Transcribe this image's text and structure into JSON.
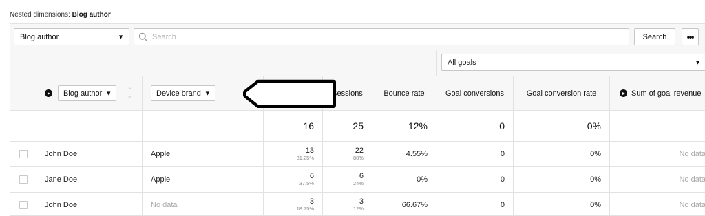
{
  "nested": {
    "prefix": "Nested dimensions:",
    "value": "Blog author"
  },
  "toolbar": {
    "dimension_select": "Blog author",
    "search_placeholder": "Search",
    "search_value": "",
    "search_button": "Search",
    "more_button": "•••"
  },
  "goals": {
    "selected": "All goals"
  },
  "columns": {
    "blog_author": "Blog author",
    "device_brand": "Device brand",
    "sessions": "Sessions",
    "bounce_rate": "Bounce rate",
    "goal_conversions": "Goal conversions",
    "goal_conversion_rate": "Goal conversion rate",
    "sum_goal_revenue": "Sum of goal revenue"
  },
  "totals": {
    "col3": "16",
    "sessions": "25",
    "bounce_rate": "12%",
    "goal_conversions": "0",
    "goal_conversion_rate": "0%"
  },
  "rows": [
    {
      "author": "John Doe",
      "device": "Apple",
      "c3": "13",
      "c3_pct": "81.25%",
      "sessions": "22",
      "sessions_pct": "88%",
      "bounce": "4.55%",
      "conversions": "0",
      "conv_rate": "0%",
      "revenue": "No data"
    },
    {
      "author": "Jane Doe",
      "device": "Apple",
      "c3": "6",
      "c3_pct": "37.5%",
      "sessions": "6",
      "sessions_pct": "24%",
      "bounce": "0%",
      "conversions": "0",
      "conv_rate": "0%",
      "revenue": "No data"
    },
    {
      "author": "John Doe",
      "device": "No data",
      "c3": "3",
      "c3_pct": "18.75%",
      "sessions": "3",
      "sessions_pct": "12%",
      "bounce": "66.67%",
      "conversions": "0",
      "conv_rate": "0%",
      "revenue": "No data"
    }
  ]
}
